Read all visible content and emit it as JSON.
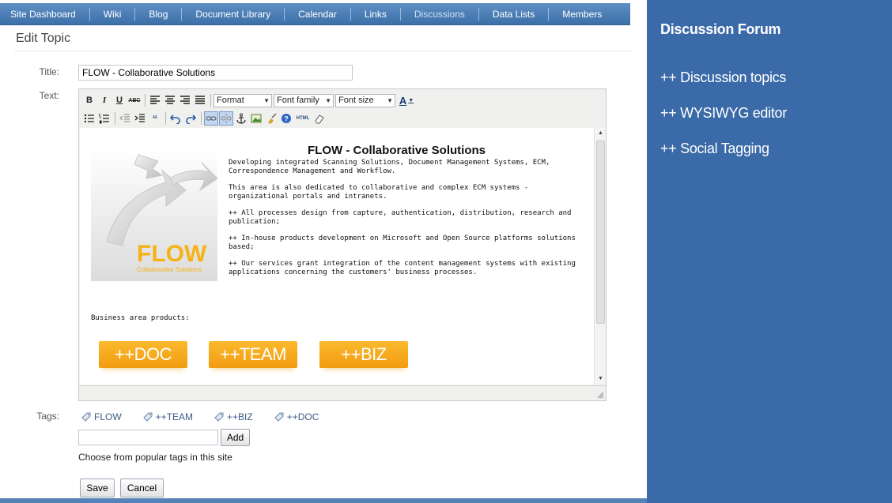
{
  "nav": {
    "items": [
      {
        "label": "Site Dashboard"
      },
      {
        "label": "Wiki"
      },
      {
        "label": "Blog"
      },
      {
        "label": "Document Library"
      },
      {
        "label": "Calendar"
      },
      {
        "label": "Links"
      },
      {
        "label": "Discussions",
        "active": true
      },
      {
        "label": "Data Lists"
      },
      {
        "label": "Members"
      }
    ]
  },
  "page": {
    "title": "Edit Topic"
  },
  "form": {
    "title_label": "Title:",
    "title_value": "FLOW - Collaborative Solutions",
    "text_label": "Text:",
    "tags_label": "Tags:"
  },
  "toolbar": {
    "format": "Format",
    "font_family": "Font family",
    "font_size": "Font size",
    "html_label": "HTML",
    "bold": "B",
    "italic": "I",
    "underline": "U",
    "strike": "ABC",
    "font_color": "A"
  },
  "editor_content": {
    "heading": "FLOW - Collaborative Solutions",
    "paragraphs": [
      "Developing integrated Scanning Solutions, Document Management Systems, ECM, Correspondence Management and Workflow.",
      "This area is also dedicated to collaborative and complex ECM systems -  organizational portals and intranets.",
      "++ All processes design from capture, authentication, distribution, research and publication;",
      "++ In-house products development on Microsoft and Open Source platforms solutions based;",
      "++ Our services grant integration of the content management systems with existing applications concerning the customers' business processes."
    ],
    "logo_text": "FLOW",
    "logo_subtext": "Collaborative Solutions",
    "business_label": "Business area products:",
    "products": [
      "++DOC",
      "++TEAM",
      "++BIZ"
    ]
  },
  "tags": {
    "items": [
      "FLOW",
      "++TEAM",
      "++BIZ",
      "++DOC"
    ],
    "input_value": "",
    "add_label": "Add",
    "popular_text": "Choose from popular tags in this site"
  },
  "actions": {
    "save_label": "Save",
    "cancel_label": "Cancel"
  },
  "side_panel": {
    "title": "Discussion Forum",
    "items": [
      "++ Discussion topics",
      "++ WYSIWYG editor",
      "++ Social Tagging"
    ]
  },
  "colors": {
    "nav_bg": "#4a7db7",
    "side_panel_bg": "#3a6aa7",
    "accent_orange": "#f7a81c",
    "tag_link": "#3c5b86"
  }
}
